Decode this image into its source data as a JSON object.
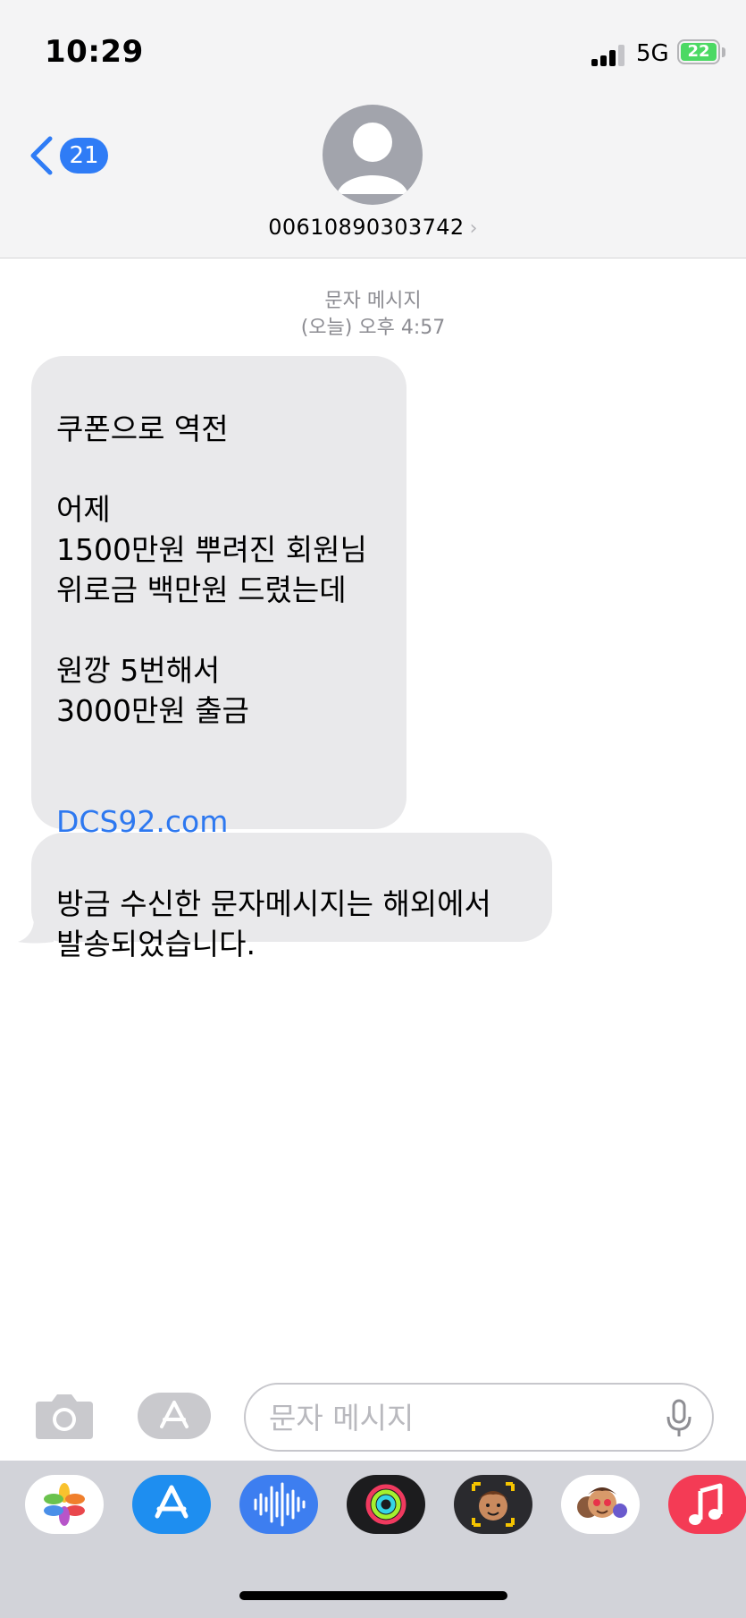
{
  "status_bar": {
    "time": "10:29",
    "network": "5G",
    "battery": "22"
  },
  "header": {
    "back_badge": "21",
    "contact_number": "00610890303742",
    "icons": [
      "chevron-left-icon",
      "avatar-placeholder-icon",
      "chevron-right-icon"
    ]
  },
  "conversation": {
    "service_label": "문자 메시지",
    "timestamp": "(오늘) 오후 4:57",
    "messages": [
      {
        "text": "쿠폰으로 역전\n\n어제\n1500만원 뿌려진 회원님\n위로금 백만원 드렸는데\n\n원깡 5번해서\n3000만원 출금\n",
        "link": "DCS92.com"
      },
      {
        "text": "방금 수신한 문자메시지는 해외에서\n발송되었습니다."
      }
    ]
  },
  "compose": {
    "placeholder": "문자 메시지",
    "icons": [
      "camera-icon",
      "app-store-icon",
      "microphone-icon"
    ]
  },
  "app_drawer": {
    "apps": [
      "photos-icon",
      "app-store-icon",
      "audio-waveform-icon",
      "activity-rings-icon",
      "memoji-icon",
      "memoji-stickers-icon",
      "music-icon"
    ]
  },
  "colors": {
    "accent": "#2f7cf6",
    "bubble_received": "#e9e9eb",
    "link": "#2d78f0",
    "header_bg": "#f4f4f5",
    "drawer_bg": "#d2d3d9"
  }
}
